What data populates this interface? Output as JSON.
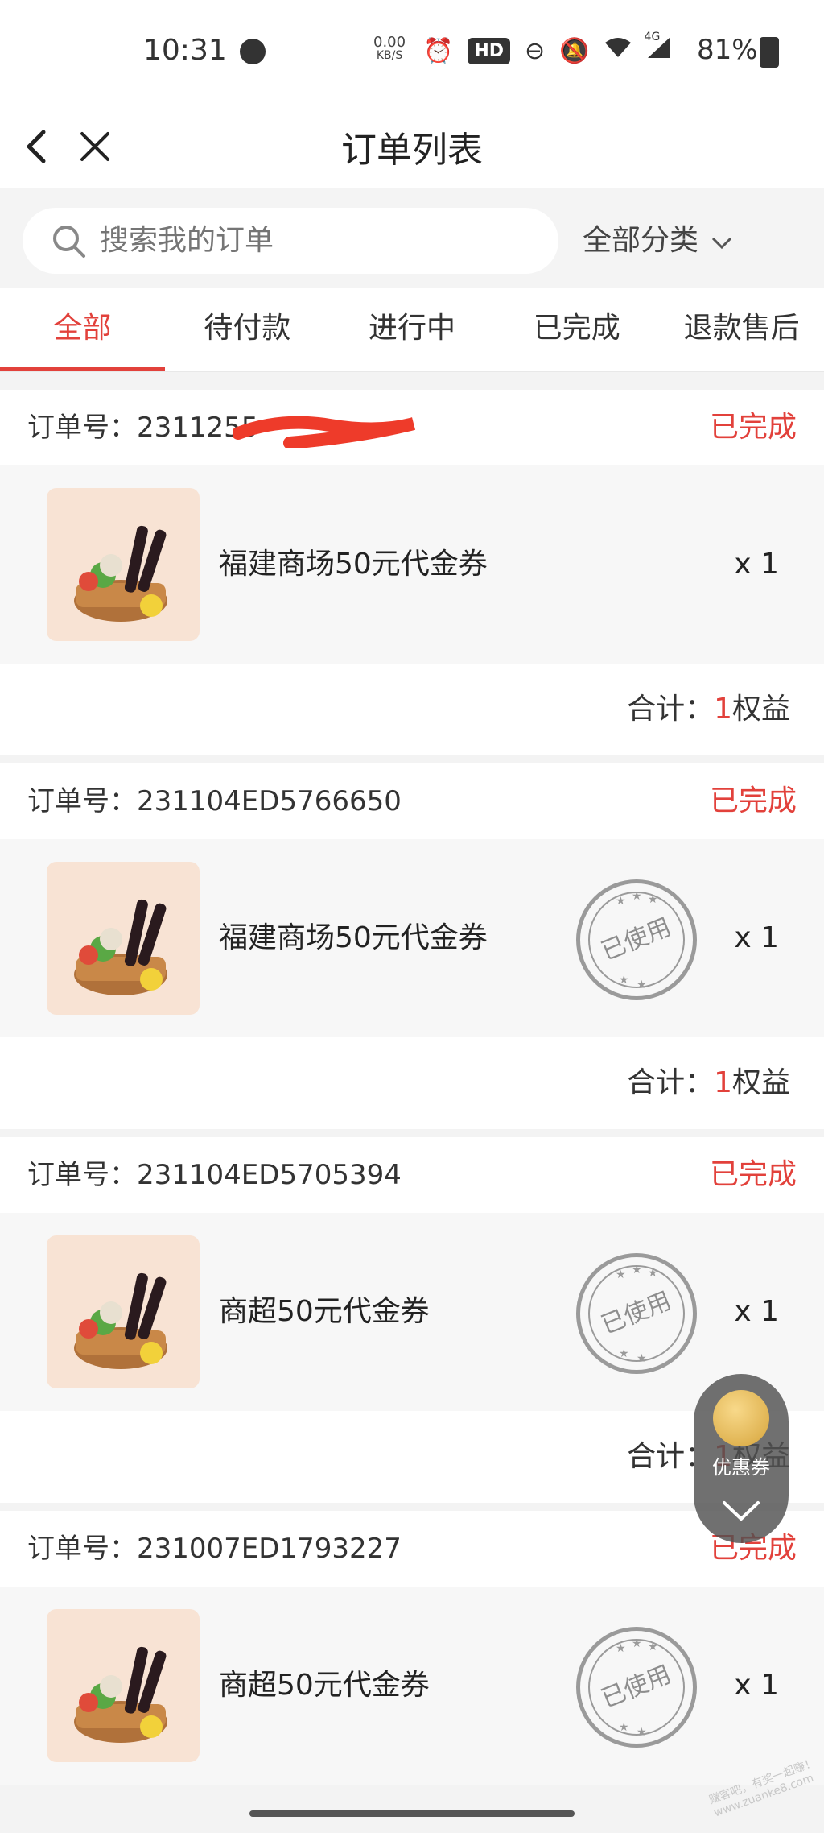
{
  "status_bar": {
    "time": "10:31",
    "net_speed_value": "0.00",
    "net_speed_unit": "KB/S",
    "hd_badge": "HD",
    "network": "4G",
    "battery": "81%"
  },
  "header": {
    "title": "订单列表"
  },
  "search": {
    "placeholder": "搜索我的订单",
    "category_label": "全部分类"
  },
  "tabs": [
    "全部",
    "待付款",
    "进行中",
    "已完成",
    "退款售后"
  ],
  "active_tab": "全部",
  "orders": [
    {
      "order_label": "订单号：",
      "order_no": "2311255",
      "status": "已完成",
      "product": "福建商场50元代金券",
      "qty": "x 1",
      "used_stamp": "",
      "total_label": "合计：",
      "total_num": "1",
      "total_unit": "权益"
    },
    {
      "order_label": "订单号：",
      "order_no": "231104ED5766650",
      "status": "已完成",
      "product": "福建商场50元代金券",
      "qty": "x 1",
      "used_stamp": "已使用",
      "total_label": "合计：",
      "total_num": "1",
      "total_unit": "权益"
    },
    {
      "order_label": "订单号：",
      "order_no": "231104ED5705394",
      "status": "已完成",
      "product": "商超50元代金券",
      "qty": "x 1",
      "used_stamp": "已使用",
      "total_label": "合计：",
      "total_num": "1",
      "total_unit": "权益"
    },
    {
      "order_label": "订单号：",
      "order_no": "231007ED1793227",
      "status": "已完成",
      "product": "商超50元代金券",
      "qty": "x 1",
      "used_stamp": "已使用"
    }
  ],
  "floating_widget": {
    "label": "优惠券"
  },
  "watermark": "赚客吧，有奖一起赚！ www.zuanke8.com",
  "colors": {
    "accent": "#e2413b",
    "page_bg": "#f3f3f3",
    "card_body_bg": "#f7f7f7"
  },
  "icons": [
    "back-arrow-icon",
    "close-icon",
    "search-icon",
    "chevron-down-icon",
    "alarm-icon",
    "do-not-disturb-icon",
    "bell-off-icon",
    "wifi-icon",
    "signal-icon",
    "battery-icon",
    "chevron-down-float-icon"
  ]
}
